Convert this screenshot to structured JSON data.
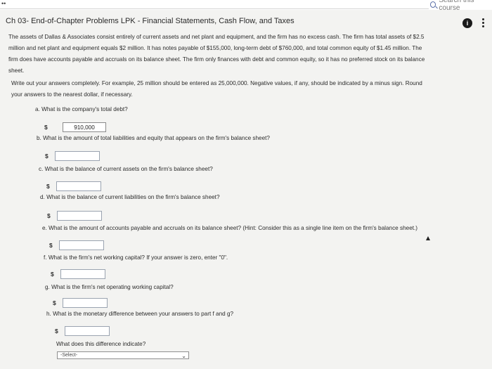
{
  "topbar": {
    "search_placeholder": "Search this course"
  },
  "page": {
    "title": "Ch 03- End-of-Chapter Problems LPK - Financial Statements, Cash Flow, and Taxes"
  },
  "problem": {
    "intro_lines": [
      "The assets of Dallas & Associates consist entirely of current assets and net plant and equipment, and the firm has no excess cash. The firm has total assets of $2.5",
      "million and net plant and equipment equals $2 million. It has notes payable of $155,000, long-term debt of $760,000, and total common equity of $1.45 million. The",
      "firm does have accounts payable and accruals on its balance sheet. The firm only finances with debt and common equity, so it has no preferred stock on its balance",
      "sheet."
    ],
    "instruction_lines": [
      "Write out your answers completely. For example, 25 million should be entered as 25,000,000. Negative values, if any, should be indicated by a minus sign. Round",
      "your answers to the nearest dollar, if necessary."
    ]
  },
  "questions": [
    {
      "text": "a. What is the company's total debt?",
      "value": "910,000"
    },
    {
      "text": "b. What is the amount of total liabilities and equity that appears on the firm's balance sheet?",
      "value": ""
    },
    {
      "text": "c. What is the balance of current assets on the firm's balance sheet?",
      "value": ""
    },
    {
      "text": "d. What is the balance of current liabilities on the firm's balance sheet?",
      "value": ""
    },
    {
      "text": "e. What is the amount of accounts payable and accruals on its balance sheet? (Hint: Consider this as a single line item on the firm's balance sheet.)",
      "value": ""
    },
    {
      "text": "f. What is the firm's net working capital? If your answer is zero, enter \"0\".",
      "value": ""
    },
    {
      "text": "g. What is the firm's net operating working capital?",
      "value": ""
    },
    {
      "text": "h. What is the monetary difference between your answers to part f and g?",
      "value": ""
    }
  ],
  "currency_symbol": "$",
  "difference": {
    "prompt": "What does this difference indicate?",
    "select_value": "-Select-"
  }
}
